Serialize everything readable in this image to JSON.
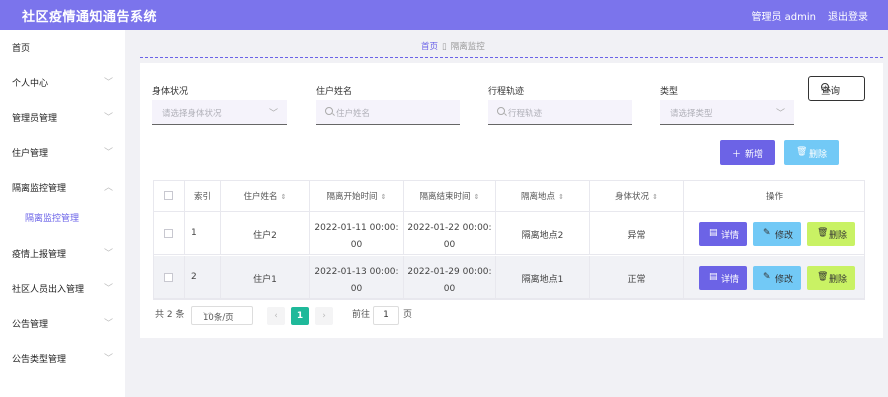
{
  "header": {
    "title": "社区疫情通知通告系统",
    "user": "管理员 admin",
    "logout": "退出登录"
  },
  "sidebar": {
    "items": [
      {
        "label": "首页"
      },
      {
        "label": "个人中心"
      },
      {
        "label": "管理员管理"
      },
      {
        "label": "住户管理"
      },
      {
        "label": "隔离监控管理"
      },
      {
        "label": "疫情上报管理"
      },
      {
        "label": "社区人员出入管理"
      },
      {
        "label": "公告管理"
      },
      {
        "label": "公告类型管理"
      }
    ],
    "sub_item": "隔离监控管理"
  },
  "breadcrumb": {
    "home": "首页",
    "current": "隔离监控"
  },
  "search": {
    "status_label": "身体状况",
    "status_placeholder": "请选择身体状况",
    "name_label": "住户姓名",
    "name_placeholder": "住户姓名",
    "track_label": "行程轨迹",
    "track_placeholder": "行程轨迹",
    "type_label": "类型",
    "type_placeholder": "请选择类型",
    "query_label": "查询"
  },
  "actions": {
    "add_label": "新增",
    "delete_label": "删除"
  },
  "table": {
    "headers": [
      "索引",
      "住户姓名",
      "隔离开始时间",
      "隔离结束时间",
      "隔离地点",
      "身体状况",
      "操作"
    ],
    "rows": [
      {
        "index": "1",
        "name": "住户2",
        "start_a": "2022-01-11 00:00:",
        "start_b": "00",
        "end_a": "2022-01-22 00:00:",
        "end_b": "00",
        "place": "隔离地点2",
        "status": "异常"
      },
      {
        "index": "2",
        "name": "住户1",
        "start_a": "2022-01-13 00:00:",
        "start_b": "00",
        "end_a": "2022-01-29 00:00:",
        "end_b": "00",
        "place": "隔离地点1",
        "status": "正常"
      }
    ],
    "row_actions": {
      "detail": "详情",
      "edit": "修改",
      "remove": "删除"
    }
  },
  "pagination": {
    "total": "共 2 条",
    "page_size": "10条/页",
    "current_page": "1",
    "goto_label": "前往",
    "goto_value": "1",
    "page_suffix": "页"
  },
  "colors": {
    "header_bg": "#7b74ec",
    "primary": "#6c63e6",
    "info": "#72c9f6",
    "lime": "#c9f264",
    "page_active": "#1fb99a"
  }
}
